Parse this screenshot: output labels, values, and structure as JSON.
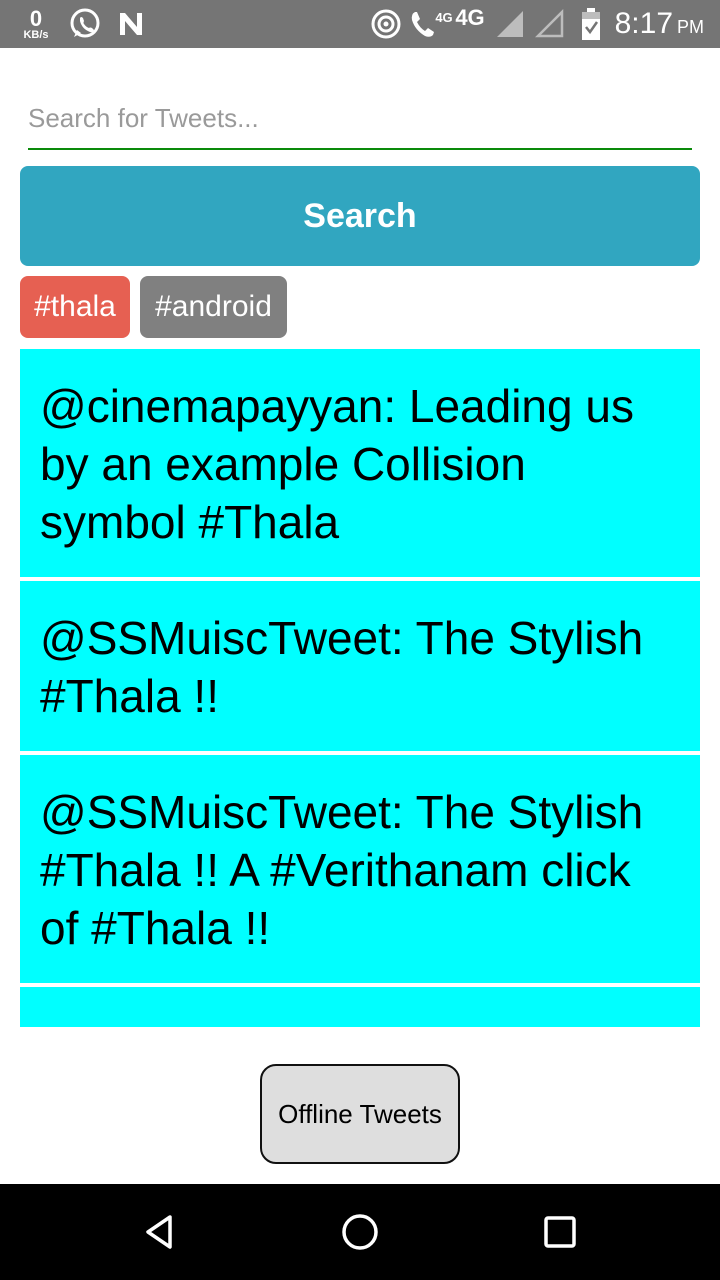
{
  "status_bar": {
    "net_speed_value": "0",
    "net_speed_unit": "KB/s",
    "network_label_small": "4G",
    "network_label": "4G",
    "time": "8:17",
    "ampm": "PM",
    "icons": [
      "whatsapp-icon",
      "n-icon",
      "hotspot-icon",
      "volte-call-icon",
      "signal-icon",
      "signal-empty-icon",
      "battery-icon"
    ]
  },
  "search": {
    "placeholder": "Search for Tweets...",
    "value": "",
    "button_label": "Search",
    "underline_color": "#0a8a0a",
    "button_color": "#31a6c0"
  },
  "hashtags": [
    {
      "label": "#thala",
      "color": "#e66052",
      "selected": true
    },
    {
      "label": "#android",
      "color": "#808080",
      "selected": false
    }
  ],
  "tweets": [
    {
      "text": "@cinemapayyan: Leading us by an example Collision symbol #Thala"
    },
    {
      "text": "@SSMuiscTweet: The Stylish #Thala !!"
    },
    {
      "text": "@SSMuiscTweet: The Stylish #Thala !! A #Verithanam click of #Thala !!"
    }
  ],
  "tweet_background": "#00ffff",
  "offline_button": {
    "label": "Offline Tweets"
  },
  "nav": {
    "icons": [
      "back-icon",
      "home-icon",
      "recents-icon"
    ]
  }
}
